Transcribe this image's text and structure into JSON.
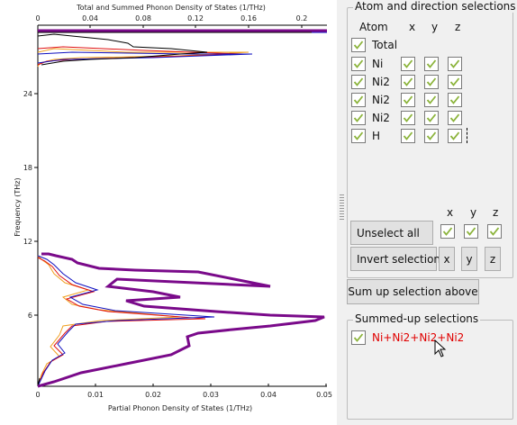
{
  "plot": {
    "top_axis_title": "Total and Summed Phonon Density of States (1/THz)",
    "bottom_axis_title": "Partial Phonon Density of States (1/THz)",
    "y_axis_title": "Frequency (THz)",
    "top_ticks": [
      "0",
      "0.04",
      "0.08",
      "0.12",
      "0.16",
      "0.2"
    ],
    "bottom_ticks": [
      "0",
      "0.01",
      "0.02",
      "0.03",
      "0.04",
      "0.05"
    ],
    "y_ticks": [
      "6",
      "12",
      "18",
      "24"
    ]
  },
  "selection_panel": {
    "title": "Atom and direction selections",
    "header_atom": "Atom",
    "header_x": "x",
    "header_y": "y",
    "header_z": "z",
    "rows": [
      {
        "label": "Total"
      },
      {
        "label": "Ni"
      },
      {
        "label": "Ni2"
      },
      {
        "label": "Ni2"
      },
      {
        "label": "Ni2"
      },
      {
        "label": "H"
      }
    ],
    "lower_header_x": "x",
    "lower_header_y": "y",
    "lower_header_z": "z",
    "unselect_all": "Unselect all",
    "invert_selection": "Invert selection",
    "btn_x": "x",
    "btn_y": "y",
    "btn_z": "z"
  },
  "sum_up_button": "Sum up selection above",
  "summed_panel": {
    "title": "Summed-up selections",
    "items": [
      {
        "label": "Ni+Ni2+Ni2+Ni2"
      }
    ]
  },
  "colors": {
    "check": "#8cb43c",
    "total_curve": "#7a0a8a",
    "summed_curve": "#000000",
    "blue_curve": "#1010c0",
    "red_curve": "#e01010",
    "orange_curve": "#f0a020",
    "summed_label": "#e00000"
  }
}
